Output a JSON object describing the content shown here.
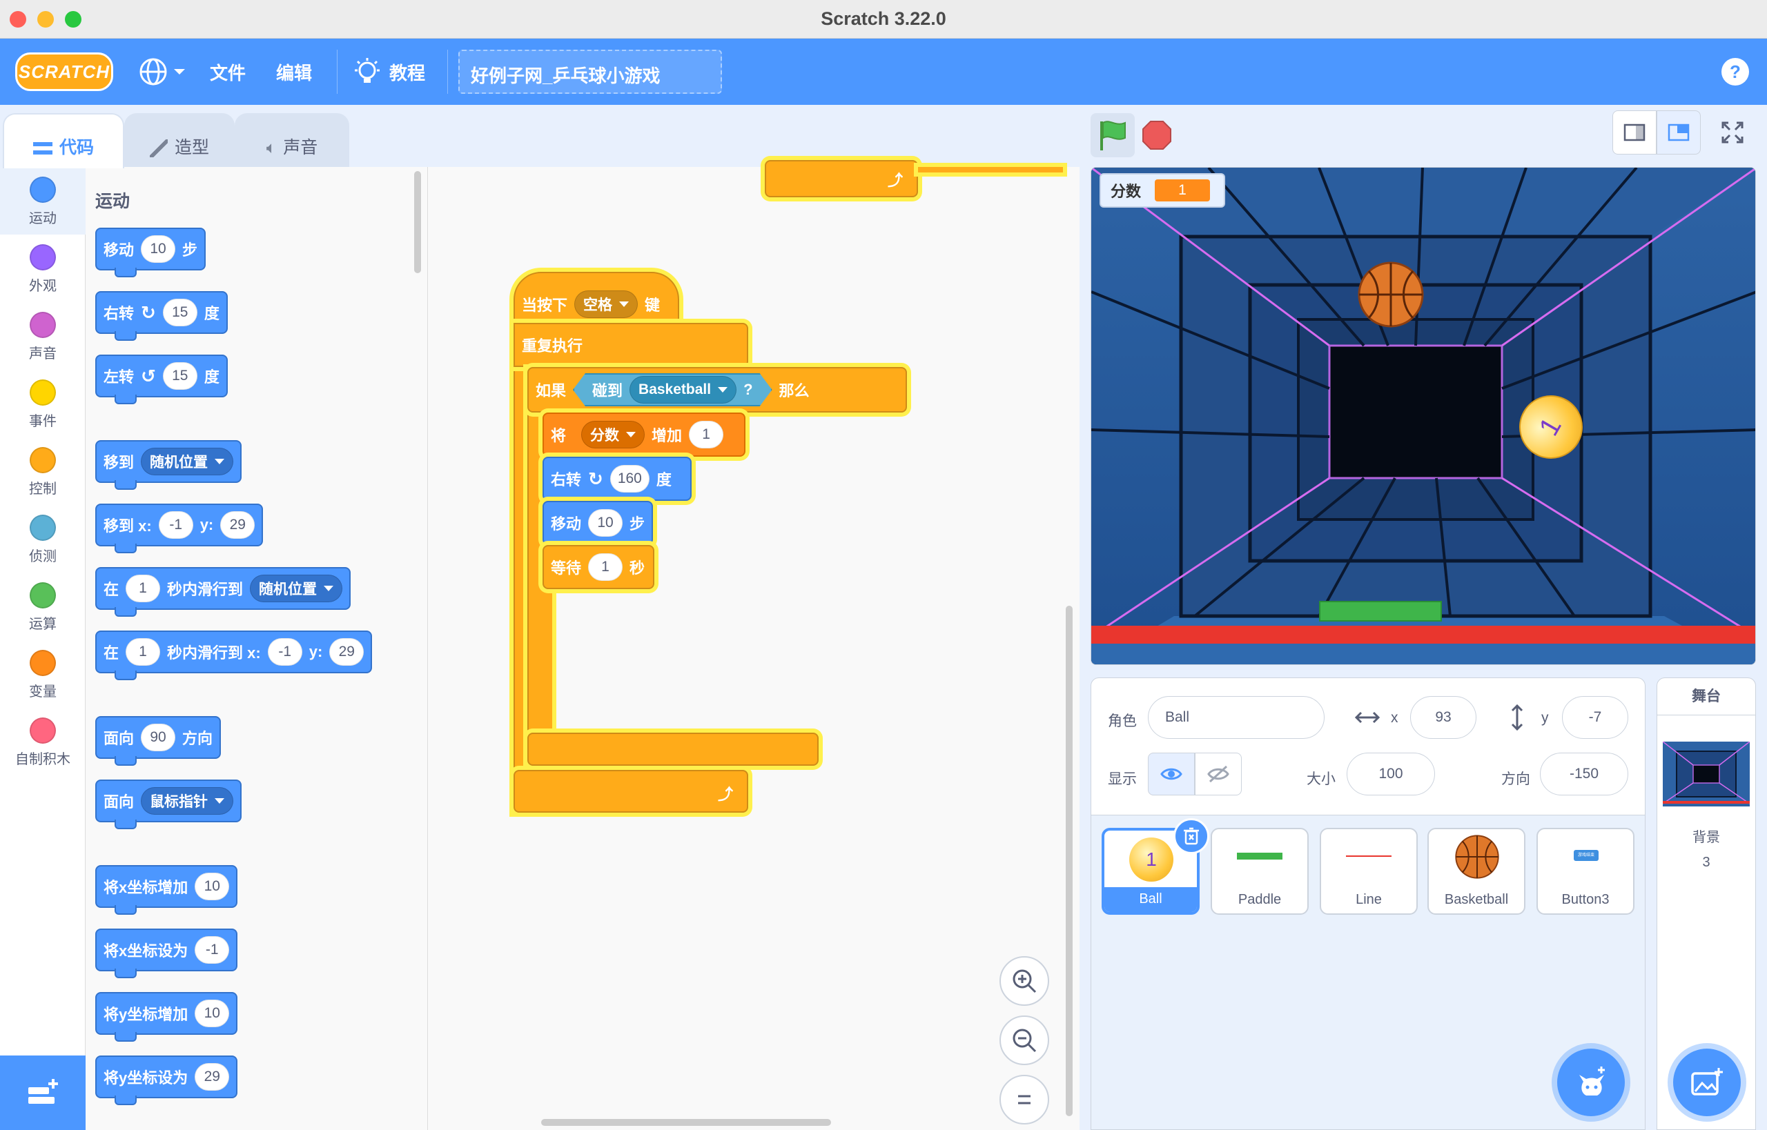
{
  "window": {
    "title": "Scratch 3.22.0"
  },
  "menubar": {
    "logo": "SCRATCH",
    "file": "文件",
    "edit": "编辑",
    "tutorials": "教程",
    "project_title": "好例子网_乒乓球小游戏",
    "help": "?"
  },
  "tabs": [
    {
      "label": "代码"
    },
    {
      "label": "造型"
    },
    {
      "label": "声音"
    }
  ],
  "categories": [
    {
      "label": "运动",
      "color": "#4c97ff"
    },
    {
      "label": "外观",
      "color": "#9966ff"
    },
    {
      "label": "声音",
      "color": "#cf63cf"
    },
    {
      "label": "事件",
      "color": "#ffd500"
    },
    {
      "label": "控制",
      "color": "#ffab19"
    },
    {
      "label": "侦测",
      "color": "#5cb1d6"
    },
    {
      "label": "运算",
      "color": "#59c059"
    },
    {
      "label": "变量",
      "color": "#ff8c1a"
    },
    {
      "label": "自制积木",
      "color": "#ff6680"
    }
  ],
  "palette": {
    "section_title": "运动",
    "move": {
      "a": "移动",
      "n": "10",
      "b": "步"
    },
    "turn_right": {
      "a": "右转",
      "n": "15",
      "b": "度"
    },
    "turn_left": {
      "a": "左转",
      "n": "15",
      "b": "度"
    },
    "goto": {
      "a": "移到",
      "opt": "随机位置"
    },
    "goto_xy": {
      "a": "移到 x:",
      "x": "-1",
      "b": "y:",
      "y": "29"
    },
    "glide": {
      "a": "在",
      "n": "1",
      "b": "秒内滑行到",
      "opt": "随机位置"
    },
    "glide_xy": {
      "a": "在",
      "n": "1",
      "b": "秒内滑行到 x:",
      "x": "-1",
      "c": "y:",
      "y": "29"
    },
    "point_dir": {
      "a": "面向",
      "n": "90",
      "b": "方向"
    },
    "point_to": {
      "a": "面向",
      "opt": "鼠标指针"
    },
    "change_x": {
      "a": "将x坐标增加",
      "n": "10"
    },
    "set_x": {
      "a": "将x坐标设为",
      "n": "-1"
    },
    "change_y": {
      "a": "将y坐标增加",
      "n": "10"
    },
    "set_y": {
      "a": "将y坐标设为",
      "n": "29"
    }
  },
  "script": {
    "hat": {
      "a": "当按下",
      "key": "空格",
      "b": "键"
    },
    "forever": "重复执行",
    "if": {
      "a": "如果",
      "touch": "碰到",
      "target": "Basketball",
      "q": "?",
      "b": "那么"
    },
    "change_var": {
      "a": "将",
      "var": "分数",
      "b": "增加",
      "n": "1"
    },
    "turn": {
      "a": "右转",
      "n": "160",
      "b": "度"
    },
    "move": {
      "a": "移动",
      "n": "10",
      "b": "步"
    },
    "wait": {
      "a": "等待",
      "n": "1",
      "b": "秒"
    }
  },
  "stage": {
    "monitor_label": "分数",
    "monitor_value": "1",
    "ball_label": "1"
  },
  "sprite_info": {
    "sprite_label": "角色",
    "sprite_name": "Ball",
    "x_label": "x",
    "x": "93",
    "y_label": "y",
    "y": "-7",
    "show_label": "显示",
    "size_label": "大小",
    "size": "100",
    "direction_label": "方向",
    "direction": "-150"
  },
  "sprites": [
    {
      "name": "Ball",
      "thumb_text": "1"
    },
    {
      "name": "Paddle"
    },
    {
      "name": "Line"
    },
    {
      "name": "Basketball"
    },
    {
      "name": "Button3",
      "thumb_text": "游戏结束"
    }
  ],
  "stage_panel": {
    "title": "舞台",
    "backdrop_label": "背景",
    "backdrop_count": "3"
  }
}
